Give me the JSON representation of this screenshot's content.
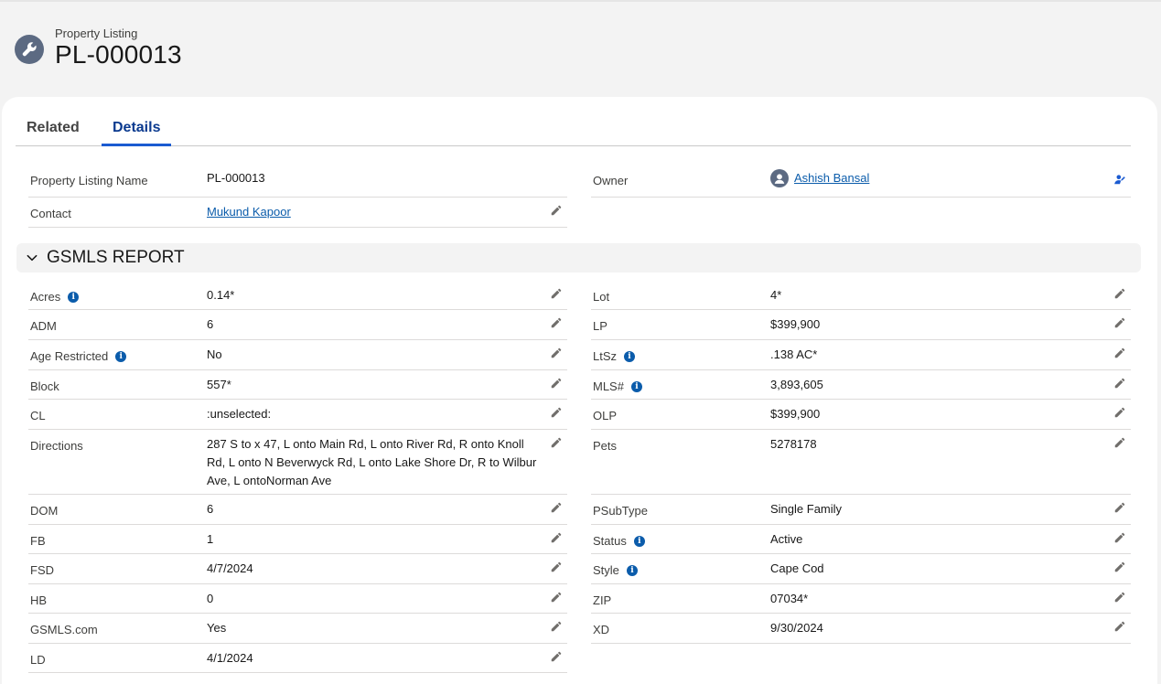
{
  "header": {
    "object_label": "Property Listing",
    "record_title": "PL-000013"
  },
  "tabs": [
    {
      "label": "Related",
      "active": false
    },
    {
      "label": "Details",
      "active": true
    }
  ],
  "top_fields": {
    "name": {
      "label": "Property Listing Name",
      "value": "PL-000013"
    },
    "owner": {
      "label": "Owner",
      "value": "Ashish Bansal"
    },
    "contact": {
      "label": "Contact",
      "value": "Mukund Kapoor"
    }
  },
  "section": {
    "title": "GSMLS REPORT",
    "expanded": true
  },
  "left_fields": [
    {
      "label": "Acres",
      "value": "0.14*",
      "info": true
    },
    {
      "label": "ADM",
      "value": "6",
      "info": false
    },
    {
      "label": "Age Restricted",
      "value": "No",
      "info": true
    },
    {
      "label": "Block",
      "value": "557*",
      "info": false
    },
    {
      "label": "CL",
      "value": ":unselected:",
      "info": false
    },
    {
      "label": "Directions",
      "value": "287 S to x 47, L onto Main Rd, L onto River Rd, R onto Knoll Rd, L onto N Beverwyck Rd, L onto Lake Shore Dr, R to Wilbur Ave, L ontoNorman Ave",
      "info": false
    },
    {
      "label": "DOM",
      "value": "6",
      "info": false
    },
    {
      "label": "FB",
      "value": "1",
      "info": false
    },
    {
      "label": "FSD",
      "value": "4/7/2024",
      "info": false
    },
    {
      "label": "HB",
      "value": "0",
      "info": false
    },
    {
      "label": "GSMLS.com",
      "value": "Yes",
      "info": false
    },
    {
      "label": "LD",
      "value": "4/1/2024",
      "info": false
    }
  ],
  "right_fields": [
    {
      "label": "Lot",
      "value": "4*",
      "info": false
    },
    {
      "label": "LP",
      "value": "$399,900",
      "info": false
    },
    {
      "label": "LtSz",
      "value": ".138 AC*",
      "info": true
    },
    {
      "label": "MLS#",
      "value": "3,893,605",
      "info": true
    },
    {
      "label": "OLP",
      "value": "$399,900",
      "info": false
    },
    {
      "label": "Pets",
      "value": "5278178",
      "info": false
    },
    {
      "label": "PSubType",
      "value": "Single Family",
      "info": false
    },
    {
      "label": "Status",
      "value": "Active",
      "info": true
    },
    {
      "label": "Style",
      "value": "Cape Cod",
      "info": true
    },
    {
      "label": "ZIP",
      "value": "07034*",
      "info": false
    },
    {
      "label": "XD",
      "value": "9/30/2024",
      "info": false
    }
  ],
  "colors": {
    "accent": "#1b5bd1",
    "link": "#0b5cab",
    "icon_gray": "#5c6a82"
  },
  "icons": {
    "record": "wrench-icon",
    "edit": "pencil-icon",
    "info": "info-icon",
    "chevron": "chevron-down-icon",
    "owner_change": "change-owner-icon",
    "avatar": "user-avatar-icon"
  }
}
